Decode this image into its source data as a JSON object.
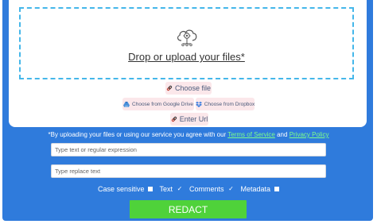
{
  "upload": {
    "drop_text": "Drop or upload your files*",
    "choose_file": "Choose file",
    "google_drive": "Choose from Google Drive",
    "dropbox": "Choose from Dropbox",
    "enter_url": "Enter Url"
  },
  "terms": {
    "prefix": "*By uploading your files or using our service you agree with our",
    "tos_link": "Terms of Service",
    "and": "and",
    "privacy_link": "Privacy Policy"
  },
  "inputs": {
    "search_placeholder": "Type text or regular expression",
    "replace_placeholder": "Type replace text"
  },
  "options": [
    {
      "label": "Case sensitive",
      "checked": false
    },
    {
      "label": "Text",
      "checked": true
    },
    {
      "label": "Comments",
      "checked": true
    },
    {
      "label": "Metadata",
      "checked": false
    }
  ],
  "action": {
    "redact_label": "REDACT"
  },
  "colors": {
    "panel_bg": "#2f7bdc",
    "dropzone_border": "#45b7ea",
    "link_green": "#7dff8a",
    "button_green": "#4fd23a",
    "pill_bg": "#fbe7ea"
  },
  "icons": {
    "upload": "cloud-gear-icon",
    "choose_file": "link-icon",
    "google_drive": "google-drive-icon",
    "dropbox": "dropbox-icon",
    "enter_url": "link-icon"
  }
}
